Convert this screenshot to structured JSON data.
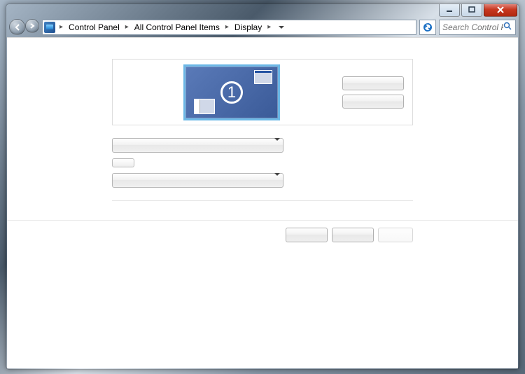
{
  "breadcrumbs": {
    "item0": "Control Panel",
    "item1": "All Control Panel Items",
    "item2": "Display"
  },
  "search": {
    "placeholder": "Search Control Panel"
  },
  "monitor": {
    "number": "1"
  },
  "panel_buttons": {
    "detect": "",
    "identify": ""
  },
  "form": {
    "select1_value": "",
    "select2_value": ""
  },
  "footer": {
    "ok": "",
    "cancel": "",
    "apply": ""
  }
}
